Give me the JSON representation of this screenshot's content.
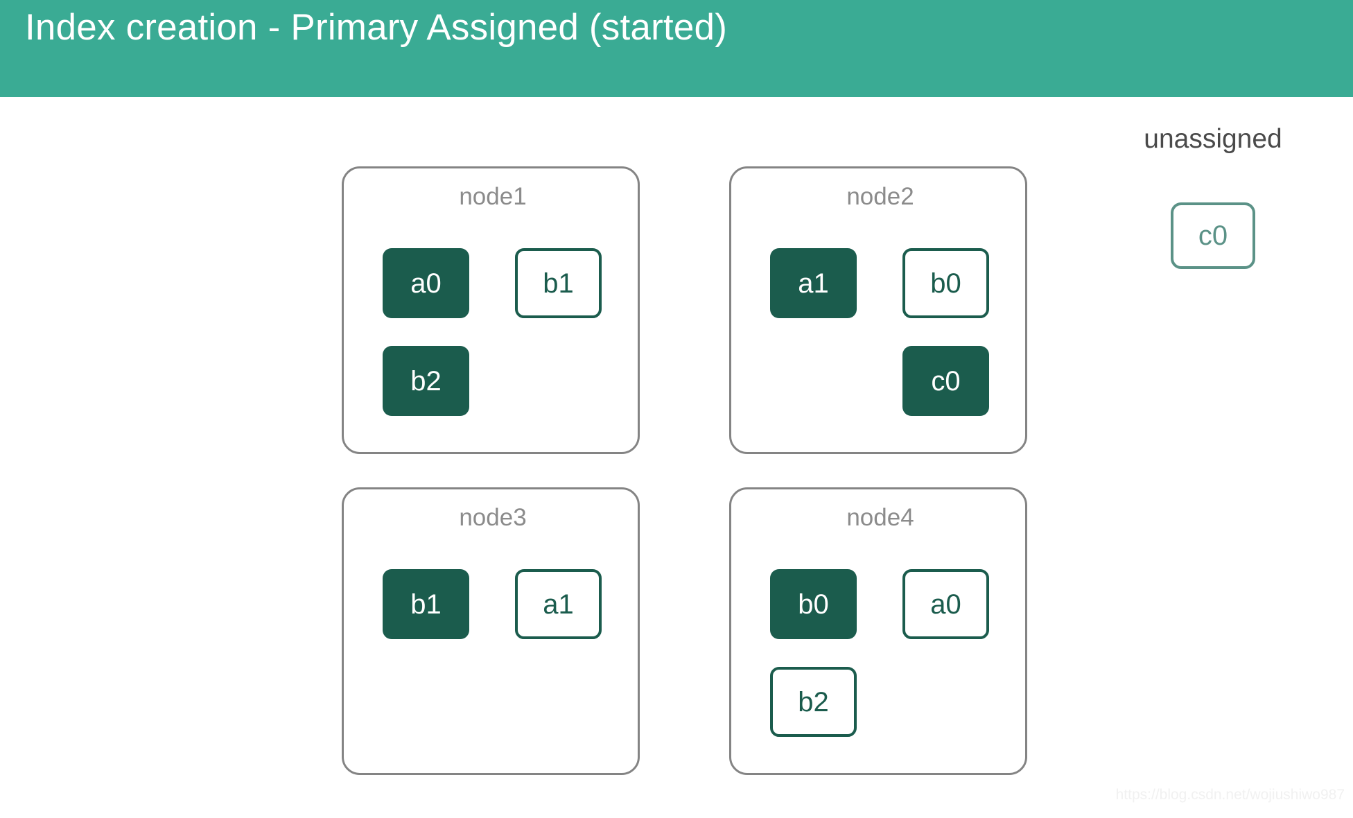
{
  "title": "Index creation - Primary Assigned (started)",
  "colors": {
    "banner": "#3AAB94",
    "banner_text": "#FFFFFF",
    "primary_fill": "#1B5C4D",
    "primary_text": "#FFFFFF",
    "replica_border": "#1B5C4D",
    "replica_text": "#1B5C4D",
    "unassigned_accent": "#5B9287",
    "node_border": "#848484",
    "node_label": "#8B8B8B",
    "unassigned_label": "#4A4A4A",
    "watermark": "#F1F1F1",
    "background": "#FFFFFF"
  },
  "nodes": [
    {
      "label": "node1",
      "rows": [
        {
          "left": {
            "label": "a0",
            "state": "primary"
          },
          "right": {
            "label": "b1",
            "state": "replica"
          }
        },
        {
          "left": {
            "label": "b2",
            "state": "primary"
          },
          "right": null
        }
      ]
    },
    {
      "label": "node2",
      "rows": [
        {
          "left": {
            "label": "a1",
            "state": "primary"
          },
          "right": {
            "label": "b0",
            "state": "replica"
          }
        },
        {
          "left": null,
          "right": {
            "label": "c0",
            "state": "primary"
          }
        }
      ]
    },
    {
      "label": "node3",
      "rows": [
        {
          "left": {
            "label": "b1",
            "state": "primary"
          },
          "right": {
            "label": "a1",
            "state": "replica"
          }
        },
        {
          "left": null,
          "right": null
        }
      ]
    },
    {
      "label": "node4",
      "rows": [
        {
          "left": {
            "label": "b0",
            "state": "primary"
          },
          "right": {
            "label": "a0",
            "state": "replica"
          }
        },
        {
          "left": {
            "label": "b2",
            "state": "replica"
          },
          "right": null
        }
      ]
    }
  ],
  "unassigned": {
    "title": "unassigned",
    "shards": [
      {
        "label": "c0",
        "state": "unassigned"
      }
    ]
  },
  "watermark": "https://blog.csdn.net/wojiushiwo987"
}
